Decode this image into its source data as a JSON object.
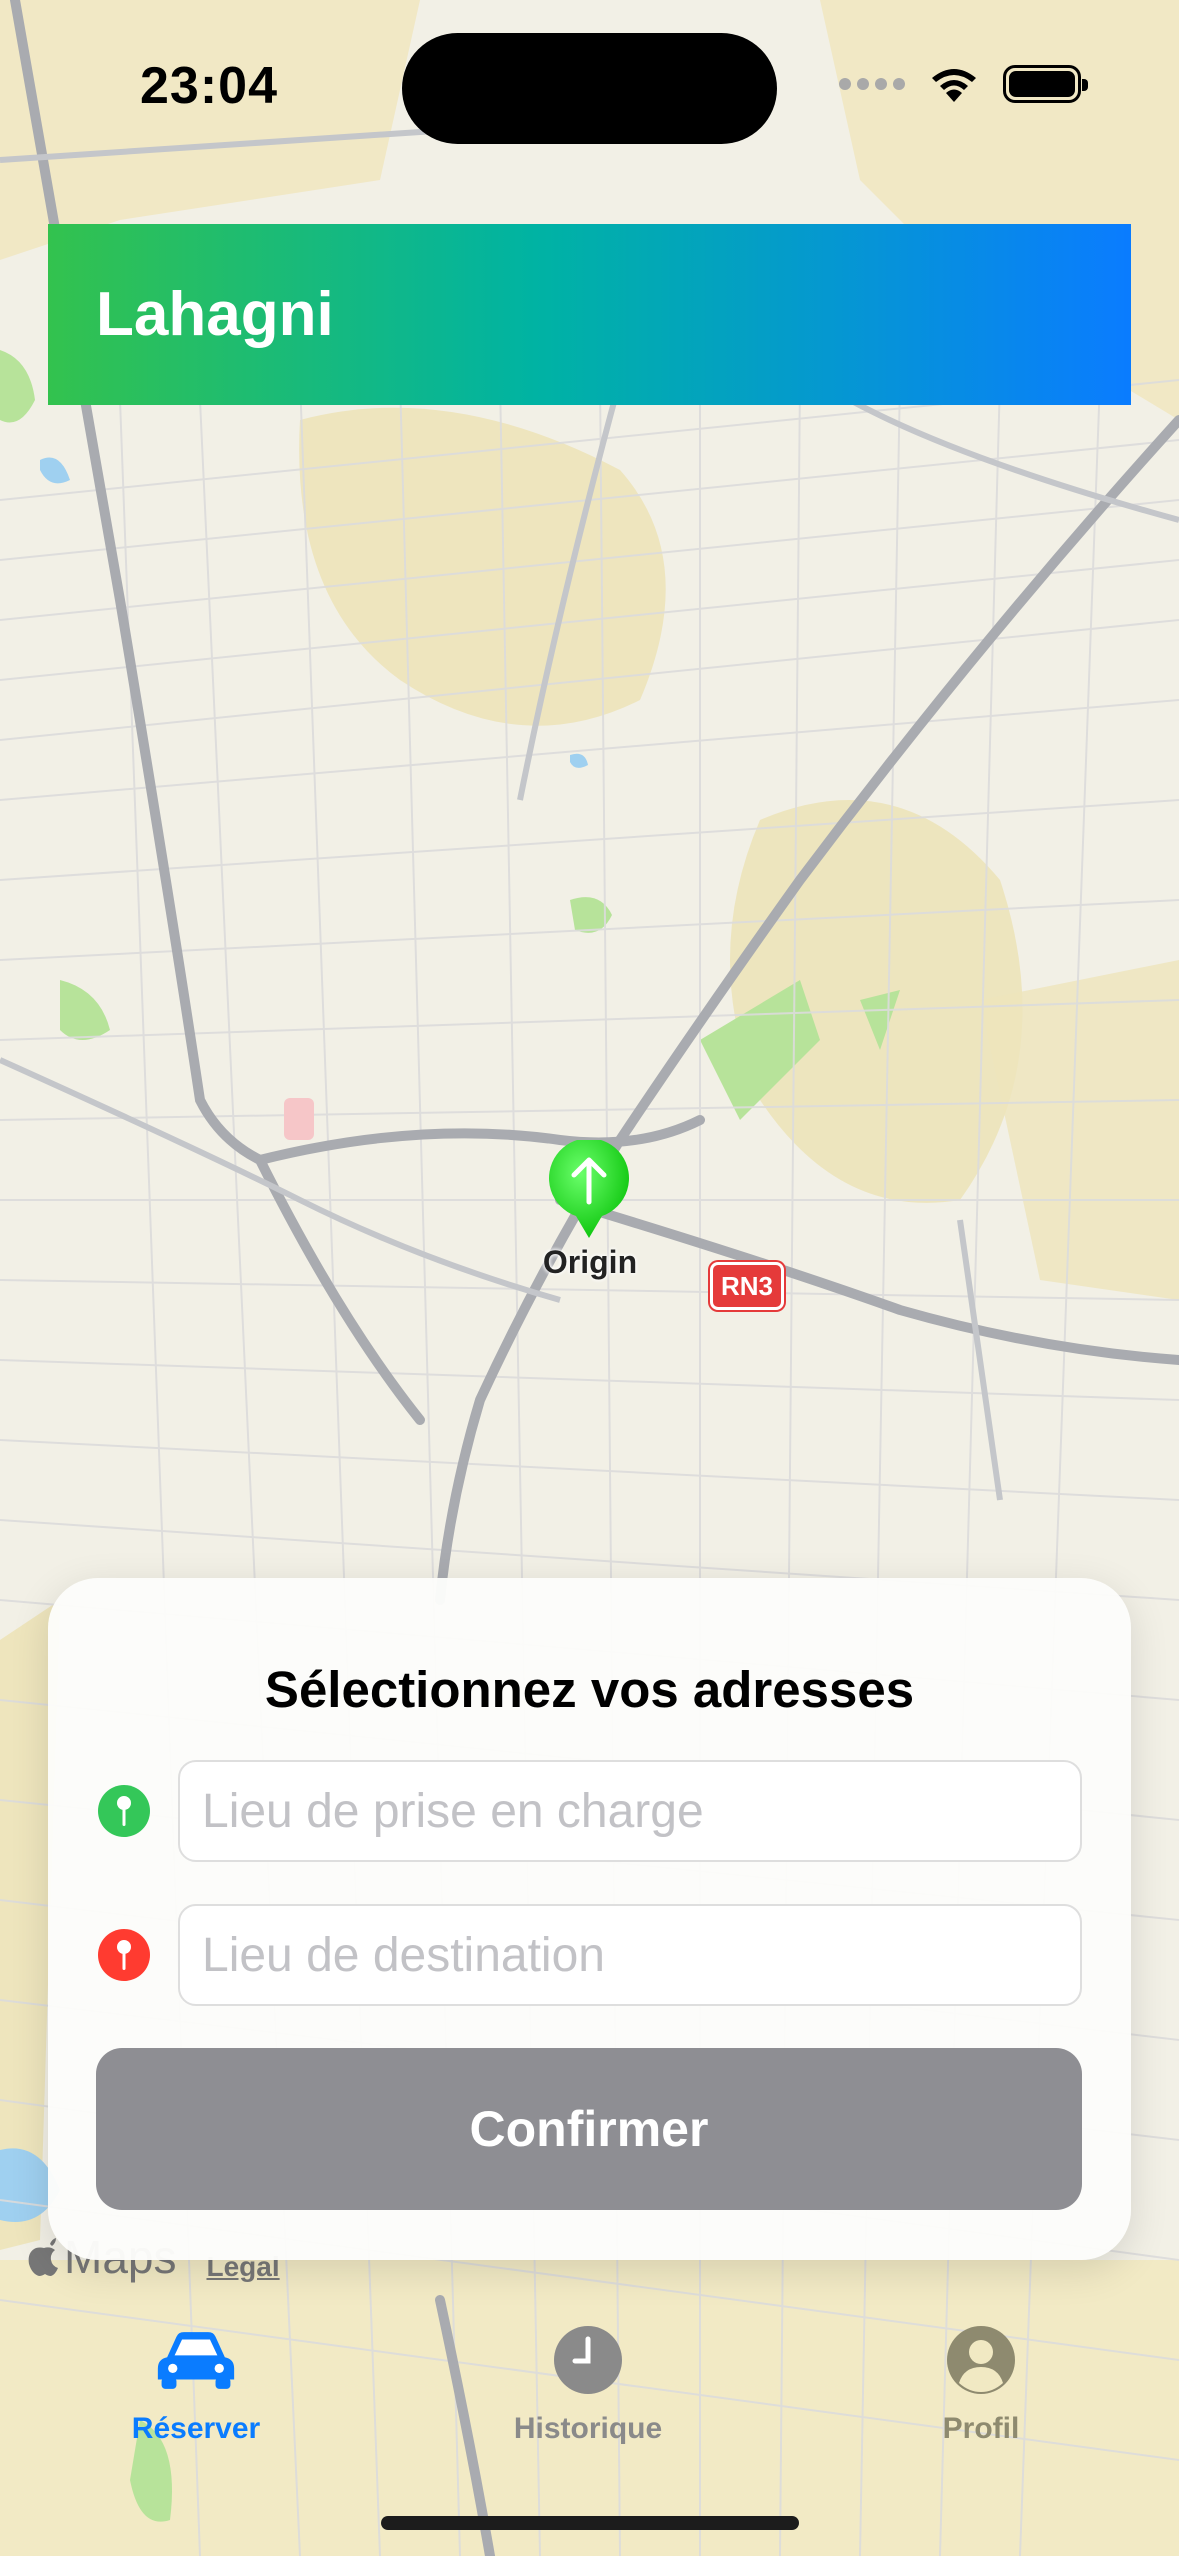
{
  "status_bar": {
    "time": "23:04"
  },
  "header": {
    "title": "Lahagni"
  },
  "map": {
    "origin_label": "Origin",
    "road_shield": "RN3",
    "attribution": {
      "maps_text": "Maps",
      "legal_text": "Legal"
    }
  },
  "address_card": {
    "title": "Sélectionnez vos adresses",
    "pickup": {
      "placeholder": "Lieu de prise en charge",
      "value": "",
      "pin_color": "#34c759"
    },
    "destination": {
      "placeholder": "Lieu de destination",
      "value": "",
      "pin_color": "#ff3b30"
    },
    "confirm_label": "Confirmer"
  },
  "tab_bar": {
    "tabs": [
      {
        "label": "Réserver",
        "icon": "car-icon",
        "selected": true
      },
      {
        "label": "Historique",
        "icon": "clock-icon",
        "selected": false
      },
      {
        "label": "Profil",
        "icon": "person-icon",
        "selected": false
      }
    ]
  },
  "colors": {
    "header_gradient_start": "#33c24e",
    "header_gradient_end": "#0a7cff",
    "accent": "#0a7cff",
    "button_disabled": "#8e8e93"
  }
}
